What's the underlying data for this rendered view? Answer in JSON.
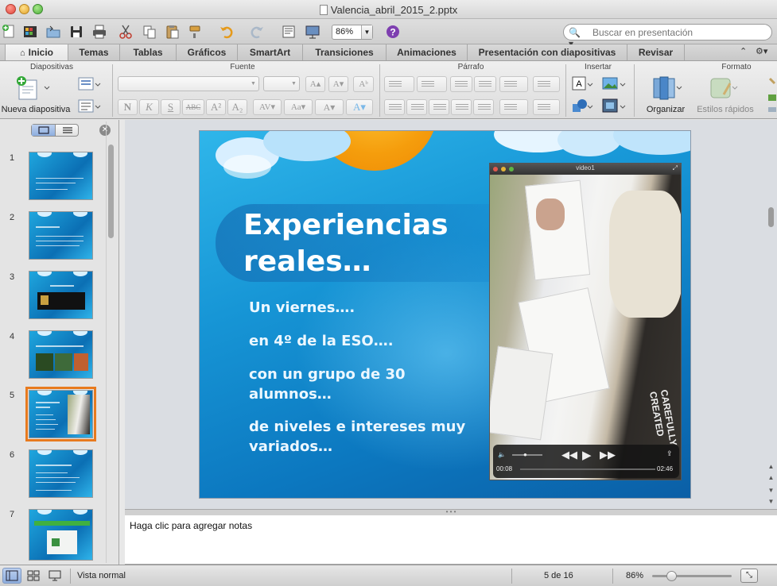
{
  "window": {
    "title": "Valencia_abril_2015_2.pptx"
  },
  "toolbar": {
    "zoom_value": "86%",
    "search_placeholder": "Buscar en presentación"
  },
  "ribbon_tabs": [
    "Inicio",
    "Temas",
    "Tablas",
    "Gráficos",
    "SmartArt",
    "Transiciones",
    "Animaciones",
    "Presentación con diapositivas",
    "Revisar"
  ],
  "ribbon": {
    "groups": {
      "diapositivas": "Diapositivas",
      "fuente": "Fuente",
      "parrafo": "Párrafo",
      "insertar": "Insertar",
      "formato": "Formato"
    },
    "nueva_diapositiva": "Nueva diapositiva",
    "organizar": "Organizar",
    "estilos_rapidos": "Estilos rápidos",
    "fmt": {
      "bold": "N",
      "italic": "K",
      "underline": "S",
      "strike": "ABC",
      "sup": "A²",
      "sub": "A₂"
    }
  },
  "thumbnails": {
    "numbers": [
      "1",
      "2",
      "3",
      "4",
      "5",
      "6",
      "7"
    ],
    "selected_index": 5
  },
  "slide": {
    "title": "Experiencias reales…",
    "bullets": [
      "Un viernes….",
      "en 4º de la ESO….",
      "con un grupo de 30 alumnos…",
      "de niveles e intereses muy variados…"
    ],
    "video": {
      "title": "video1",
      "time_elapsed": "00:08",
      "time_total": "02:46"
    }
  },
  "notes": {
    "placeholder": "Haga clic para agregar notas"
  },
  "statusbar": {
    "view_name": "Vista normal",
    "slide_position": "5 de 16",
    "zoom": "86%"
  }
}
